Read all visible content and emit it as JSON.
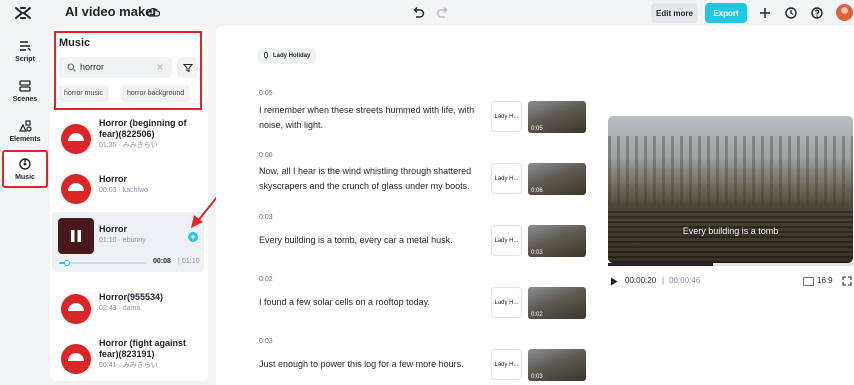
{
  "header": {
    "app_title": "AI video maker",
    "edit_more_label": "Edit more",
    "export_label": "Export",
    "colors": {
      "export_bg": "#22c7e0"
    }
  },
  "rail": {
    "items": [
      {
        "label": "Script",
        "icon": "script-icon"
      },
      {
        "label": "Scenes",
        "icon": "scenes-icon"
      },
      {
        "label": "Elements",
        "icon": "elements-icon"
      },
      {
        "label": "Music",
        "icon": "music-icon",
        "active": true
      }
    ]
  },
  "music": {
    "title": "Music",
    "search_value": "horror",
    "chips": [
      "horror music",
      "horror background"
    ],
    "tracks": [
      {
        "title": "Horror (beginning of fear)(822506)",
        "meta": "01:35 · みみきらい"
      },
      {
        "title": "Horror",
        "meta": "00:03 · kachiwo"
      },
      {
        "title": "Horror",
        "meta": "01:10 · ebunny",
        "playing": true,
        "current": "00:08",
        "separator": "|",
        "total": "01:10",
        "progress": 0.09
      },
      {
        "title": "Horror(955534)",
        "meta": "02:43 · dama"
      },
      {
        "title": "Horror (fight against fear)(823191)",
        "meta": "00:41 · みみきらい"
      }
    ]
  },
  "script": {
    "voice": "Lady Holiday",
    "segments": [
      {
        "time": "0:05",
        "text": "I remember when these streets hummed with life, with noise, with light.",
        "voice_short": "Lady H...",
        "clip_time": "0:05"
      },
      {
        "time": "0:06",
        "text": "Now, all I hear is the wind whistling through shattered skyscrapers and the crunch of glass under my boots.",
        "voice_short": "Lady H...",
        "clip_time": "0:06"
      },
      {
        "time": "0:03",
        "text": "Every building is a tomb, every car a metal husk.",
        "voice_short": "Lady H...",
        "clip_time": "0:03"
      },
      {
        "time": "0:02",
        "text": "I found a few solar cells on a rooftop today.",
        "voice_short": "Lady H...",
        "clip_time": "0:02"
      },
      {
        "time": "0:03",
        "text": "Just enough to power this log for a few more hours.",
        "voice_short": "Lady H...",
        "clip_time": "0:03"
      }
    ]
  },
  "preview": {
    "caption": "Every building is a tomb",
    "current_time": "00:00:20",
    "separator": "|",
    "total_time": "00:00:46",
    "progress": 0.43,
    "aspect_ratio": "16:9"
  }
}
